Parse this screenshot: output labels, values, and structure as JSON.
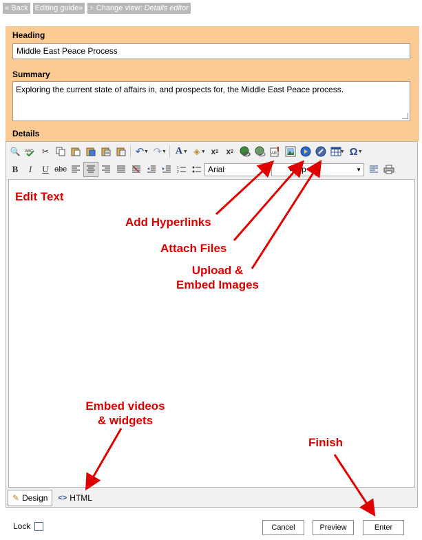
{
  "topnav": {
    "back": "« Back",
    "editing_guide": "Editing guide»",
    "change_view_prefix": "+ Change view:",
    "change_view_value": "Details editor"
  },
  "form": {
    "heading_label": "Heading",
    "heading_value": "Middle East Peace Process",
    "summary_label": "Summary",
    "summary_value": "Exploring the current state of affairs in, and prospects for, the Middle East Peace process.",
    "details_label": "Details"
  },
  "toolbar": {
    "font_name": "Arial",
    "font_size": "",
    "format": "p"
  },
  "editor_tabs": {
    "design": "Design",
    "html": "HTML"
  },
  "annotations": {
    "edit_text": "Edit Text",
    "add_hyperlinks": "Add Hyperlinks",
    "attach_files": "Attach Files",
    "upload_embed_line1": "Upload &",
    "upload_embed_line2": "Embed Images",
    "embed_videos_line1": "Embed videos",
    "embed_videos_line2": "& widgets",
    "finish": "Finish"
  },
  "footer": {
    "lock_label": "Lock",
    "cancel": "Cancel",
    "preview": "Preview",
    "enter": "Enter"
  },
  "colors": {
    "panel_bg": "#fbcb93",
    "annotation": "#e00000",
    "nav_bg": "#b9b9b9"
  }
}
